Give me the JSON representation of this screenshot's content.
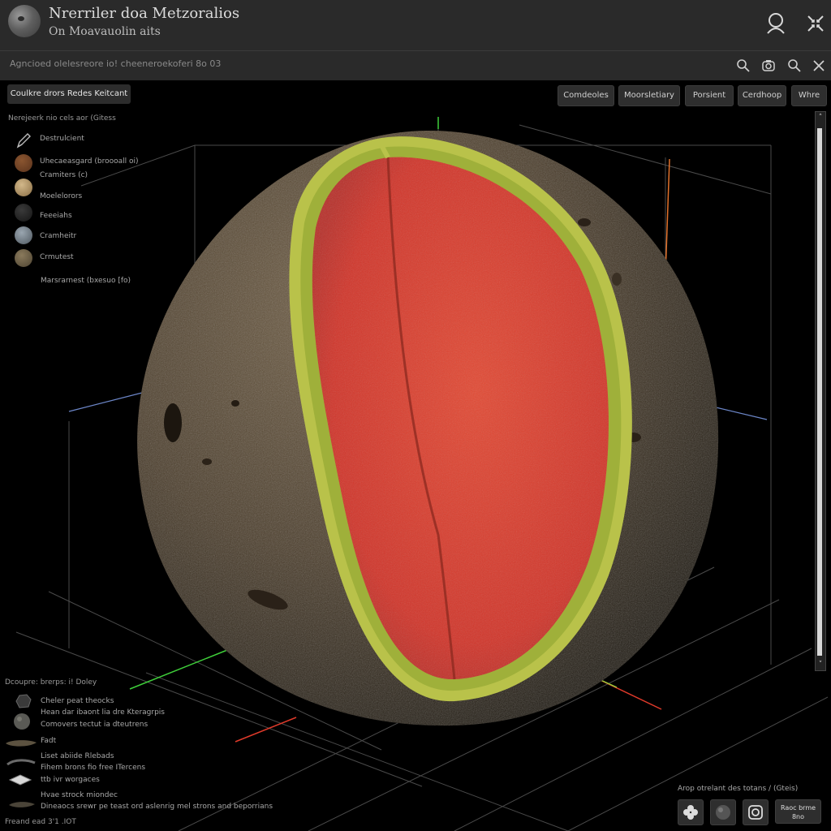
{
  "header": {
    "title": "Nrerriler doa Metzoralios",
    "subtitle": "On Moavauolin aits"
  },
  "search": {
    "placeholder": "Agncioed olelesreore io! cheeneroekoferi 8o 03"
  },
  "panel": {
    "title_button": "Coulkre drors Redes Keitcant",
    "layers_title": "Nerejeerk nio cels aor (Gitess",
    "layers": [
      {
        "label": "Destrulcient",
        "swatch": "#1a1a1a",
        "icon": "pen-icon"
      },
      {
        "label": "Uhecaeasgard (broooall oi)",
        "swatch": "#6b3b22",
        "icon": ""
      },
      {
        "label": "Cramiters (c)",
        "swatch": "#b59a6e",
        "icon": ""
      },
      {
        "label": "Moelelorors",
        "swatch": "#2a2a2a",
        "icon": ""
      },
      {
        "label": "Feeeiahs",
        "swatch": "#6f7880",
        "icon": ""
      },
      {
        "label": "Cramheitr",
        "swatch": "#6a5c45",
        "icon": ""
      },
      {
        "label": "Crmutest",
        "swatch": "",
        "icon": ""
      }
    ],
    "layers_footer": "Marsrarnest (bxesuo [fo)"
  },
  "tabs": [
    {
      "label": "Comdeoles"
    },
    {
      "label": "Moorsletiary"
    },
    {
      "label": "Porsient"
    },
    {
      "label": "Cerdhoop"
    },
    {
      "label": "Whre"
    }
  ],
  "annotations": {
    "title": "Dcoupre: brerps: i! Doley",
    "rows": [
      "Cheler peat theocks",
      "Hean dar ibaont lia dre Kteragrpis",
      "Comovers tectut ia dteutrens",
      "Fadt",
      "Liset abiide Rlebads",
      "Fihem brons fio free ITercens",
      "ttb ivr worgaces",
      "Hvae strock miondec",
      "Dineaocs srewr pe teast ord aslenrig mel strons and beporrians"
    ],
    "footer": "Freand ead 3'1 .IOT"
  },
  "capture": {
    "title": "Arop otrelant des totans / (Gteis)",
    "wide_button": "Raoc brme 8no"
  },
  "colors": {
    "accent_green": "#3fcf3a",
    "accent_red": "#e03a2a",
    "accent_blue": "#6c86c8",
    "accent_orange": "#e2712a",
    "interior_red": "#d93a2c",
    "rind_yellow": "#b9c24a",
    "crust_brown": "#4d3f2c"
  }
}
